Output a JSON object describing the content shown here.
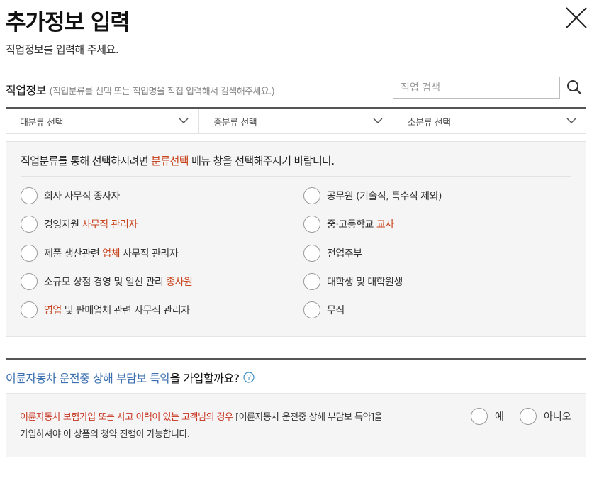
{
  "header": {
    "title": "추가정보 입력",
    "subtitle": "직업정보를 입력해 주세요.",
    "close_icon": "close-icon"
  },
  "job": {
    "label": "직업정보",
    "hint": "(직업분류를 선택 또는 직업명을 직접 입력해서 검색해주세요.)",
    "search_placeholder": "직업 검색",
    "search_icon": "search-icon",
    "categories": [
      {
        "label": "대분류 선택"
      },
      {
        "label": "중분류 선택"
      },
      {
        "label": "소분류 선택"
      }
    ]
  },
  "job_box": {
    "info_pre": "직업분류를 통해 선택하시려면 ",
    "info_hl": "분류선택",
    "info_post": " 메뉴 창을 선택해주시기 바랍니다.",
    "options_left": [
      {
        "pre": "회사 사무직 종사자",
        "hl": "",
        "post": ""
      },
      {
        "pre": "경영지원 ",
        "hl": "사무직 관리자",
        "post": ""
      },
      {
        "pre": "제품 생산관련 ",
        "hl": "업체",
        "post": " 사무직 관리자"
      },
      {
        "pre": "소규모 상점 경영 및 일선 관리 ",
        "hl": "종사원",
        "post": ""
      },
      {
        "pre": "",
        "hl": "영업",
        "post": " 및 판매업체 관련 사무직 관리자"
      }
    ],
    "options_right": [
      {
        "pre": "공무원 (기술직, 특수직 제외)",
        "hl": "",
        "post": ""
      },
      {
        "pre": "중·고등학교 ",
        "hl": "교사",
        "post": ""
      },
      {
        "pre": "전업주부",
        "hl": "",
        "post": ""
      },
      {
        "pre": "대학생 및 대학원생",
        "hl": "",
        "post": ""
      },
      {
        "pre": "무직",
        "hl": "",
        "post": ""
      }
    ]
  },
  "rider": {
    "question_blue": "이륜자동차 운전중 상해 부담보 특약",
    "question_dark": "을 가입할까요?",
    "help_icon": "help-icon",
    "notice_red": "이륜자동차 보험가입 또는 사고 이력이 있는 고객님의 경우",
    "notice_rest": " [이륜자동차 운전중 상해 부담보 특약]을",
    "notice_line2": "가입하셔야 이 상품의 청약 진행이 가능합니다.",
    "yes_label": "예",
    "no_label": "아니오"
  },
  "colors": {
    "highlight": "#c8451f",
    "blue": "#3b6fb0",
    "red": "#c8331f"
  }
}
